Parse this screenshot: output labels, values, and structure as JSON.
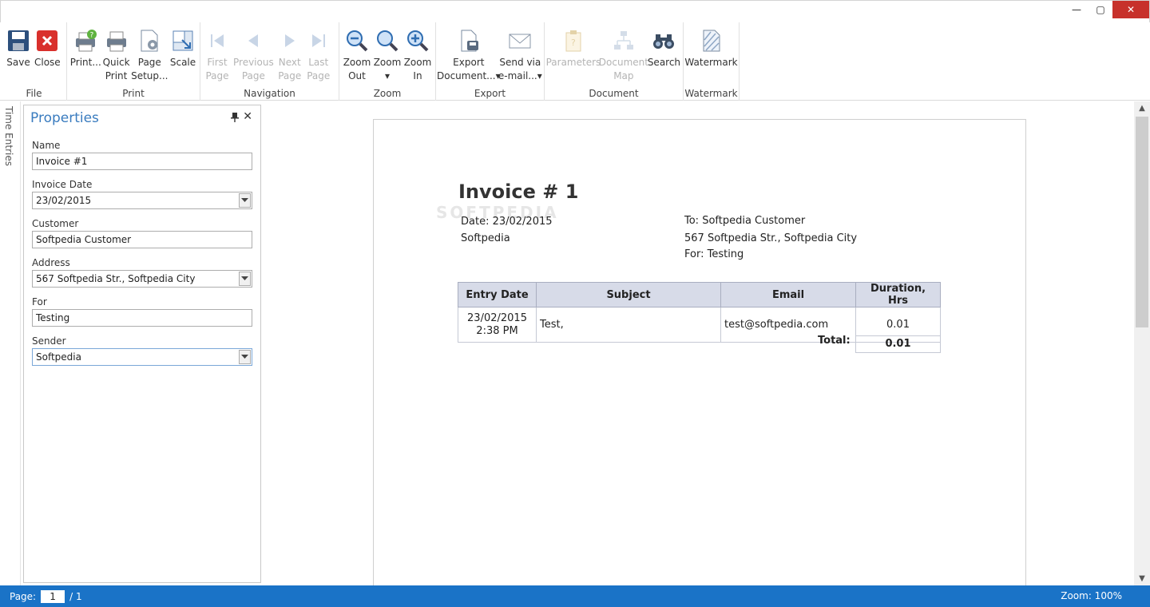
{
  "window": {
    "minimize_glyph": "—",
    "maximize_glyph": "▢",
    "close_glyph": "✕"
  },
  "ribbon": {
    "groups": {
      "file": "File",
      "print": "Print",
      "navigation": "Navigation",
      "zoom": "Zoom",
      "export": "Export",
      "document": "Document",
      "watermark": "Watermark"
    },
    "buttons": {
      "save": [
        "Save",
        ""
      ],
      "close": [
        "Close",
        ""
      ],
      "print": [
        "Print...",
        ""
      ],
      "quick_print": [
        "Quick",
        "Print"
      ],
      "page_setup": [
        "Page",
        "Setup..."
      ],
      "scale": [
        "Scale",
        ""
      ],
      "first_page": [
        "First",
        "Page"
      ],
      "previous_page": [
        "Previous",
        "Page"
      ],
      "next_page": [
        "Next",
        "Page"
      ],
      "last_page": [
        "Last",
        "Page"
      ],
      "zoom_out": [
        "Zoom",
        "Out"
      ],
      "zoom": [
        "Zoom",
        "▾"
      ],
      "zoom_in": [
        "Zoom",
        "In"
      ],
      "export_document": [
        "Export",
        "Document...▾"
      ],
      "send_via_email": [
        "Send via",
        "e-mail...▾"
      ],
      "parameters": [
        "Parameters",
        ""
      ],
      "document_map": [
        "Document",
        "Map"
      ],
      "search": [
        "Search",
        ""
      ],
      "watermark": [
        "Watermark",
        ""
      ]
    },
    "colors": {
      "disabled_text": "#b4b4b4",
      "accent": "#3a7cbf"
    }
  },
  "side_tab": "Time Entries",
  "properties": {
    "title": "Properties",
    "pin_glyph": "📌",
    "close_glyph": "✕",
    "fields": {
      "name": {
        "label": "Name",
        "value": "Invoice #1"
      },
      "invoice_date": {
        "label": "Invoice Date",
        "value": "23/02/2015"
      },
      "customer": {
        "label": "Customer",
        "value": "Softpedia Customer"
      },
      "address": {
        "label": "Address",
        "value": "567 Softpedia Str., Softpedia City"
      },
      "for": {
        "label": "For",
        "value": "Testing"
      },
      "sender": {
        "label": "Sender",
        "value": "Softpedia"
      }
    }
  },
  "invoice": {
    "title": "Invoice # 1",
    "watermark": "SOFTPEDIA",
    "date_line": "Date: 23/02/2015",
    "sender": "Softpedia",
    "to_line": "To: Softpedia Customer",
    "address_line": "567 Softpedia Str., Softpedia City",
    "for_line": "For: Testing",
    "table": {
      "headers": {
        "entry_date": "Entry Date",
        "subject": "Subject",
        "email": "Email",
        "duration": "Duration, Hrs"
      },
      "rows": [
        {
          "date": "23/02/2015",
          "time": "2:38 PM",
          "subject": "Test,",
          "email": "test@softpedia.com",
          "duration": "0.01"
        }
      ],
      "total_label": "Total:",
      "total_value": "0.01"
    }
  },
  "status": {
    "page_label": "Page:",
    "page_value": "1",
    "page_of": "/ 1",
    "zoom": "Zoom: 100%",
    "color": "#1a73c7"
  },
  "scrollbar": {
    "up_glyph": "▲",
    "down_glyph": "▼"
  }
}
